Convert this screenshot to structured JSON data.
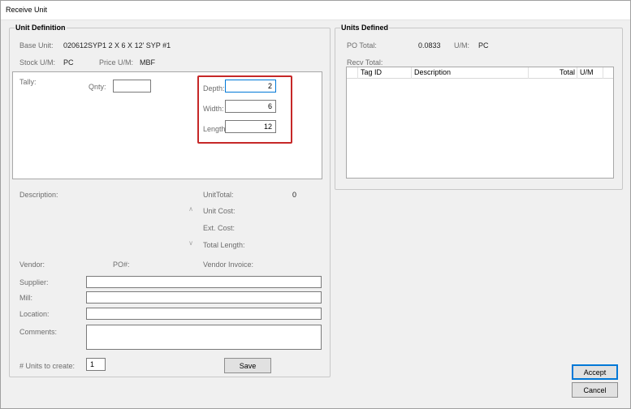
{
  "window": {
    "title": "Receive Unit"
  },
  "unit_definition": {
    "legend": "Unit Definition",
    "base_unit_label": "Base Unit:",
    "base_unit_value": "020612SYP1  2 X 6 X 12' SYP #1",
    "stock_um_label": "Stock U/M:",
    "stock_um_value": "PC",
    "price_um_label": "Price U/M:",
    "price_um_value": "MBF",
    "tally": {
      "label": "Tally:",
      "qnty_label": "Qnty:",
      "qnty_value": "",
      "depth_label": "Depth:",
      "depth_value": "2",
      "width_label": "Width:",
      "width_value": "6",
      "length_label": "Length:",
      "length_value": "12"
    },
    "description_label": "Description:",
    "unit_total_label": "UnitTotal:",
    "unit_total_value": "0",
    "unit_cost_label": "Unit Cost:",
    "ext_cost_label": "Ext. Cost:",
    "total_length_label": "Total Length:",
    "vendor_label": "Vendor:",
    "po_label": "PO#:",
    "vendor_invoice_label": "Vendor Invoice:",
    "supplier_label": "Supplier:",
    "supplier_value": "",
    "mill_label": "Mill:",
    "mill_value": "",
    "location_label": "Location:",
    "location_value": "",
    "comments_label": "Comments:",
    "comments_value": "",
    "units_to_create_label": "# Units to create:",
    "units_to_create_value": "1",
    "save_label": "Save"
  },
  "units_defined": {
    "legend": "Units Defined",
    "po_total_label": "PO Total:",
    "po_total_value": "0.0833",
    "um_label": "U/M:",
    "um_value": "PC",
    "recv_total_label": "Recv Total:",
    "columns": [
      "Tag ID",
      "Description",
      "Total",
      "U/M"
    ]
  },
  "buttons": {
    "accept": "Accept",
    "cancel": "Cancel"
  }
}
